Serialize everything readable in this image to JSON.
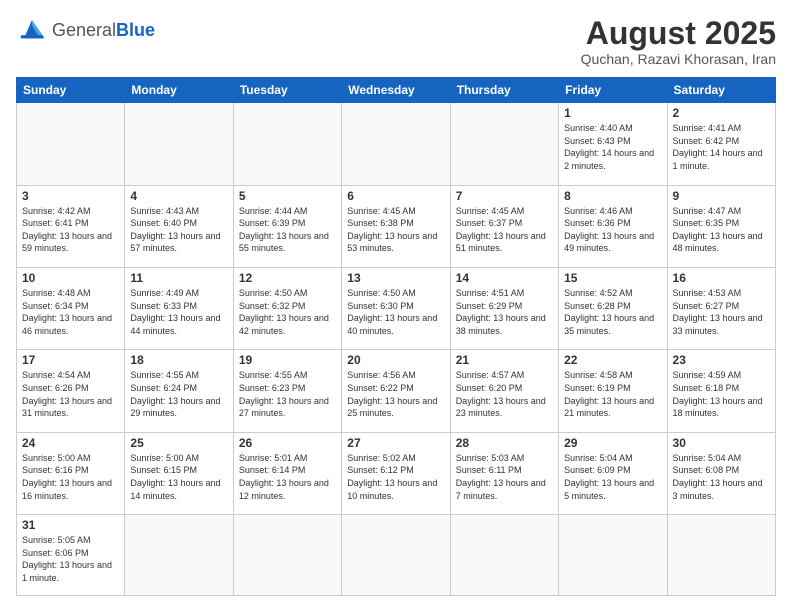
{
  "header": {
    "logo_general": "General",
    "logo_blue": "Blue",
    "title": "August 2025",
    "location": "Quchan, Razavi Khorasan, Iran"
  },
  "days_of_week": [
    "Sunday",
    "Monday",
    "Tuesday",
    "Wednesday",
    "Thursday",
    "Friday",
    "Saturday"
  ],
  "weeks": [
    [
      {
        "day": "",
        "info": ""
      },
      {
        "day": "",
        "info": ""
      },
      {
        "day": "",
        "info": ""
      },
      {
        "day": "",
        "info": ""
      },
      {
        "day": "",
        "info": ""
      },
      {
        "day": "1",
        "info": "Sunrise: 4:40 AM\nSunset: 6:43 PM\nDaylight: 14 hours and 2 minutes."
      },
      {
        "day": "2",
        "info": "Sunrise: 4:41 AM\nSunset: 6:42 PM\nDaylight: 14 hours and 1 minute."
      }
    ],
    [
      {
        "day": "3",
        "info": "Sunrise: 4:42 AM\nSunset: 6:41 PM\nDaylight: 13 hours and 59 minutes."
      },
      {
        "day": "4",
        "info": "Sunrise: 4:43 AM\nSunset: 6:40 PM\nDaylight: 13 hours and 57 minutes."
      },
      {
        "day": "5",
        "info": "Sunrise: 4:44 AM\nSunset: 6:39 PM\nDaylight: 13 hours and 55 minutes."
      },
      {
        "day": "6",
        "info": "Sunrise: 4:45 AM\nSunset: 6:38 PM\nDaylight: 13 hours and 53 minutes."
      },
      {
        "day": "7",
        "info": "Sunrise: 4:45 AM\nSunset: 6:37 PM\nDaylight: 13 hours and 51 minutes."
      },
      {
        "day": "8",
        "info": "Sunrise: 4:46 AM\nSunset: 6:36 PM\nDaylight: 13 hours and 49 minutes."
      },
      {
        "day": "9",
        "info": "Sunrise: 4:47 AM\nSunset: 6:35 PM\nDaylight: 13 hours and 48 minutes."
      }
    ],
    [
      {
        "day": "10",
        "info": "Sunrise: 4:48 AM\nSunset: 6:34 PM\nDaylight: 13 hours and 46 minutes."
      },
      {
        "day": "11",
        "info": "Sunrise: 4:49 AM\nSunset: 6:33 PM\nDaylight: 13 hours and 44 minutes."
      },
      {
        "day": "12",
        "info": "Sunrise: 4:50 AM\nSunset: 6:32 PM\nDaylight: 13 hours and 42 minutes."
      },
      {
        "day": "13",
        "info": "Sunrise: 4:50 AM\nSunset: 6:30 PM\nDaylight: 13 hours and 40 minutes."
      },
      {
        "day": "14",
        "info": "Sunrise: 4:51 AM\nSunset: 6:29 PM\nDaylight: 13 hours and 38 minutes."
      },
      {
        "day": "15",
        "info": "Sunrise: 4:52 AM\nSunset: 6:28 PM\nDaylight: 13 hours and 35 minutes."
      },
      {
        "day": "16",
        "info": "Sunrise: 4:53 AM\nSunset: 6:27 PM\nDaylight: 13 hours and 33 minutes."
      }
    ],
    [
      {
        "day": "17",
        "info": "Sunrise: 4:54 AM\nSunset: 6:26 PM\nDaylight: 13 hours and 31 minutes."
      },
      {
        "day": "18",
        "info": "Sunrise: 4:55 AM\nSunset: 6:24 PM\nDaylight: 13 hours and 29 minutes."
      },
      {
        "day": "19",
        "info": "Sunrise: 4:55 AM\nSunset: 6:23 PM\nDaylight: 13 hours and 27 minutes."
      },
      {
        "day": "20",
        "info": "Sunrise: 4:56 AM\nSunset: 6:22 PM\nDaylight: 13 hours and 25 minutes."
      },
      {
        "day": "21",
        "info": "Sunrise: 4:57 AM\nSunset: 6:20 PM\nDaylight: 13 hours and 23 minutes."
      },
      {
        "day": "22",
        "info": "Sunrise: 4:58 AM\nSunset: 6:19 PM\nDaylight: 13 hours and 21 minutes."
      },
      {
        "day": "23",
        "info": "Sunrise: 4:59 AM\nSunset: 6:18 PM\nDaylight: 13 hours and 18 minutes."
      }
    ],
    [
      {
        "day": "24",
        "info": "Sunrise: 5:00 AM\nSunset: 6:16 PM\nDaylight: 13 hours and 16 minutes."
      },
      {
        "day": "25",
        "info": "Sunrise: 5:00 AM\nSunset: 6:15 PM\nDaylight: 13 hours and 14 minutes."
      },
      {
        "day": "26",
        "info": "Sunrise: 5:01 AM\nSunset: 6:14 PM\nDaylight: 13 hours and 12 minutes."
      },
      {
        "day": "27",
        "info": "Sunrise: 5:02 AM\nSunset: 6:12 PM\nDaylight: 13 hours and 10 minutes."
      },
      {
        "day": "28",
        "info": "Sunrise: 5:03 AM\nSunset: 6:11 PM\nDaylight: 13 hours and 7 minutes."
      },
      {
        "day": "29",
        "info": "Sunrise: 5:04 AM\nSunset: 6:09 PM\nDaylight: 13 hours and 5 minutes."
      },
      {
        "day": "30",
        "info": "Sunrise: 5:04 AM\nSunset: 6:08 PM\nDaylight: 13 hours and 3 minutes."
      }
    ],
    [
      {
        "day": "31",
        "info": "Sunrise: 5:05 AM\nSunset: 6:06 PM\nDaylight: 13 hours and 1 minute."
      },
      {
        "day": "",
        "info": ""
      },
      {
        "day": "",
        "info": ""
      },
      {
        "day": "",
        "info": ""
      },
      {
        "day": "",
        "info": ""
      },
      {
        "day": "",
        "info": ""
      },
      {
        "day": "",
        "info": ""
      }
    ]
  ]
}
